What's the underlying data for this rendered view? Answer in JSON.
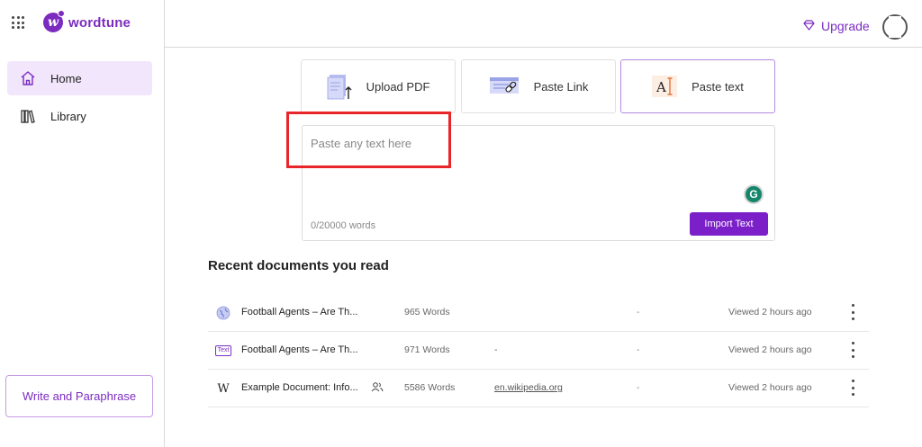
{
  "app": {
    "logo_text": "wordtune",
    "logo_letter": "w",
    "upgrade_label": "Upgrade"
  },
  "sidebar": {
    "items": [
      {
        "label": "Home",
        "icon": "home-icon",
        "active": true
      },
      {
        "label": "Library",
        "icon": "library-icon",
        "active": false
      }
    ],
    "write_button": "Write and Paraphrase"
  },
  "source_tabs": [
    {
      "label": "Upload PDF",
      "icon": "pdf-upload-icon"
    },
    {
      "label": "Paste Link",
      "icon": "link-icon"
    },
    {
      "label": "Paste text",
      "icon": "text-cursor-icon",
      "selected": true
    }
  ],
  "text_input": {
    "placeholder": "Paste any text here",
    "word_count": "0/20000 words",
    "grammarly_letter": "G",
    "import_button": "Import Text"
  },
  "recent": {
    "title": "Recent documents you read",
    "rows": [
      {
        "icon": "globe-icon",
        "title": "Football Agents – Are Th...",
        "words": "965 Words",
        "source": "",
        "dash": "-",
        "viewed": "Viewed 2 hours ago"
      },
      {
        "icon": "text-badge-icon",
        "badge": "Text",
        "title": "Football Agents – Are Th...",
        "words": "971 Words",
        "source": "-",
        "dash": "-",
        "viewed": "Viewed 2 hours ago"
      },
      {
        "icon": "wikipedia-icon",
        "badge": "W",
        "title": "Example Document: Info...",
        "shared": true,
        "words": "5586 Words",
        "source": "en.wikipedia.org",
        "dash": "-",
        "viewed": "Viewed 2 hours ago"
      }
    ]
  },
  "colors": {
    "brand": "#7b2cbf",
    "active_bg": "#f1e6fb",
    "import_button": "#7b1fc9",
    "highlight": "#e8262a",
    "grammarly": "#15866b"
  }
}
